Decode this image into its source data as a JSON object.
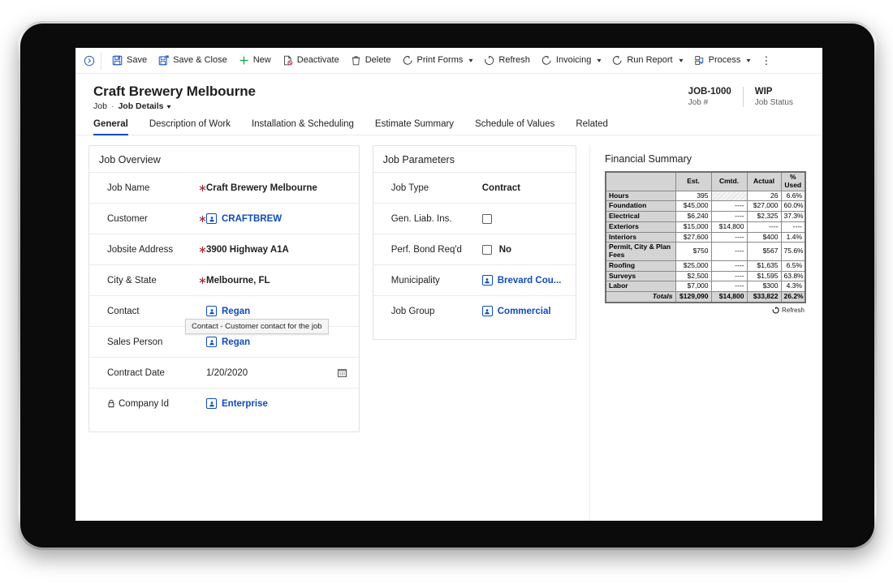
{
  "command_bar": {
    "expand_icon": "chevron-circle-icon",
    "buttons": [
      {
        "label": "Save",
        "icon": "save-icon",
        "caret": false
      },
      {
        "label": "Save & Close",
        "icon": "save-close-icon",
        "caret": false
      },
      {
        "label": "New",
        "icon": "plus-icon",
        "caret": false
      },
      {
        "label": "Deactivate",
        "icon": "deactivate-icon",
        "caret": false
      },
      {
        "label": "Delete",
        "icon": "trash-icon",
        "caret": false
      },
      {
        "label": "Print Forms",
        "icon": "flow-icon",
        "caret": true
      },
      {
        "label": "Refresh",
        "icon": "refresh-icon",
        "caret": false
      },
      {
        "label": "Invoicing",
        "icon": "flow-icon",
        "caret": true
      },
      {
        "label": "Run Report",
        "icon": "flow-icon",
        "caret": true
      },
      {
        "label": "Process",
        "icon": "process-icon",
        "caret": true
      }
    ],
    "overflow_label": "⋮"
  },
  "header": {
    "title": "Craft Brewery Melbourne",
    "breadcrumb_root": "Job",
    "breadcrumb_separator": "·",
    "breadcrumb_current": "Job Details",
    "fields": [
      {
        "value": "JOB-1000",
        "label": "Job #"
      },
      {
        "value": "WIP",
        "label": "Job Status"
      }
    ]
  },
  "tabs": [
    {
      "label": "General",
      "active": true
    },
    {
      "label": "Description of Work",
      "active": false
    },
    {
      "label": "Installation & Scheduling",
      "active": false
    },
    {
      "label": "Estimate Summary",
      "active": false
    },
    {
      "label": "Schedule of Values",
      "active": false
    },
    {
      "label": "Related",
      "active": false
    }
  ],
  "job_overview": {
    "title": "Job Overview",
    "tooltip": "Contact - Customer contact for the job",
    "fields": [
      {
        "label": "Job Name",
        "required": true,
        "value": "Craft Brewery Melbourne",
        "type": "text-bold"
      },
      {
        "label": "Customer",
        "required": true,
        "value": "CRAFTBREW",
        "type": "lookup"
      },
      {
        "label": "Jobsite Address",
        "required": true,
        "value": "3900 Highway A1A",
        "type": "text-bold"
      },
      {
        "label": "City & State",
        "required": true,
        "value": "Melbourne, FL",
        "type": "text-bold"
      },
      {
        "label": "Contact",
        "required": false,
        "value": "Regan",
        "type": "lookup"
      },
      {
        "label": "Sales Person",
        "required": false,
        "value": "Regan",
        "type": "lookup"
      },
      {
        "label": "Contract Date",
        "required": false,
        "value": "1/20/2020",
        "type": "date"
      },
      {
        "label": "Company Id",
        "required": false,
        "value": "Enterprise",
        "type": "lookup",
        "locked": true
      }
    ]
  },
  "job_parameters": {
    "title": "Job Parameters",
    "fields": [
      {
        "label": "Job Type",
        "value": "Contract",
        "type": "text-bold"
      },
      {
        "label": "Gen. Liab. Ins.",
        "value": "",
        "type": "checkbox",
        "checked": false
      },
      {
        "label": "Perf. Bond Req'd",
        "value": "No",
        "type": "checkbox",
        "checked": false
      },
      {
        "label": "Municipality",
        "value": "Brevard Cou...",
        "type": "lookup"
      },
      {
        "label": "Job Group",
        "value": "Commercial",
        "type": "lookup"
      }
    ]
  },
  "financial_summary": {
    "title": "Financial Summary",
    "refresh_label": "Refresh",
    "columns": [
      "",
      "Est.",
      "Cmtd.",
      "Actual",
      "% Used"
    ],
    "rows": [
      {
        "name": "Hours",
        "est": "395",
        "cmtd": "",
        "actual": "26",
        "used": "6.6%",
        "cmtd_disabled": true
      },
      {
        "name": "Foundation",
        "est": "$45,000",
        "cmtd": "----",
        "actual": "$27,000",
        "used": "60.0%"
      },
      {
        "name": "Electrical",
        "est": "$6,240",
        "cmtd": "----",
        "actual": "$2,325",
        "used": "37.3%"
      },
      {
        "name": "Exteriors",
        "est": "$15,000",
        "cmtd": "$14,800",
        "actual": "----",
        "used": "----"
      },
      {
        "name": "Interiors",
        "est": "$27,600",
        "cmtd": "----",
        "actual": "$400",
        "used": "1.4%"
      },
      {
        "name": "Permit, City & Plan Fees",
        "est": "$750",
        "cmtd": "----",
        "actual": "$567",
        "used": "75.6%"
      },
      {
        "name": "Roofing",
        "est": "$25,000",
        "cmtd": "----",
        "actual": "$1,635",
        "used": "6.5%"
      },
      {
        "name": "Surveys",
        "est": "$2,500",
        "cmtd": "----",
        "actual": "$1,595",
        "used": "63.8%"
      },
      {
        "name": "Labor",
        "est": "$7,000",
        "cmtd": "----",
        "actual": "$300",
        "used": "4.3%"
      }
    ],
    "totals": {
      "name": "Totals",
      "est": "$129,090",
      "cmtd": "$14,800",
      "actual": "$33,822",
      "used": "26.2%"
    }
  },
  "colors": {
    "accent": "#0f4bbd",
    "required": "#a4262c",
    "new_green": "#17a04a",
    "deactivate_red": "#c4314b",
    "text": "#201f1e",
    "muted": "#605e5c"
  }
}
